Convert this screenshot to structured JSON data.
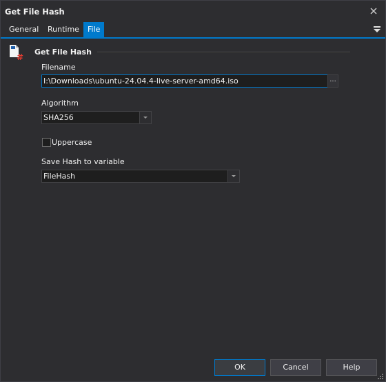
{
  "window": {
    "title": "Get File Hash"
  },
  "tabs": [
    {
      "label": "General"
    },
    {
      "label": "Runtime"
    },
    {
      "label": "File"
    }
  ],
  "section": {
    "title": "Get File Hash",
    "icon": "file-hash-icon"
  },
  "fields": {
    "filename": {
      "label": "Filename",
      "value": "I:\\Downloads\\ubuntu-24.04.4-live-server-amd64.iso",
      "browse_label": "..."
    },
    "algorithm": {
      "label": "Algorithm",
      "value": "SHA256"
    },
    "uppercase": {
      "label": "Uppercase",
      "checked": false
    },
    "save_hash": {
      "label": "Save Hash to variable",
      "value": "FileHash"
    }
  },
  "buttons": {
    "ok": "OK",
    "cancel": "Cancel",
    "help": "Help"
  },
  "colors": {
    "accent": "#007acc",
    "background": "#2d2d30",
    "input_bg": "#1e1e1e",
    "icon_red": "#e03c31"
  }
}
